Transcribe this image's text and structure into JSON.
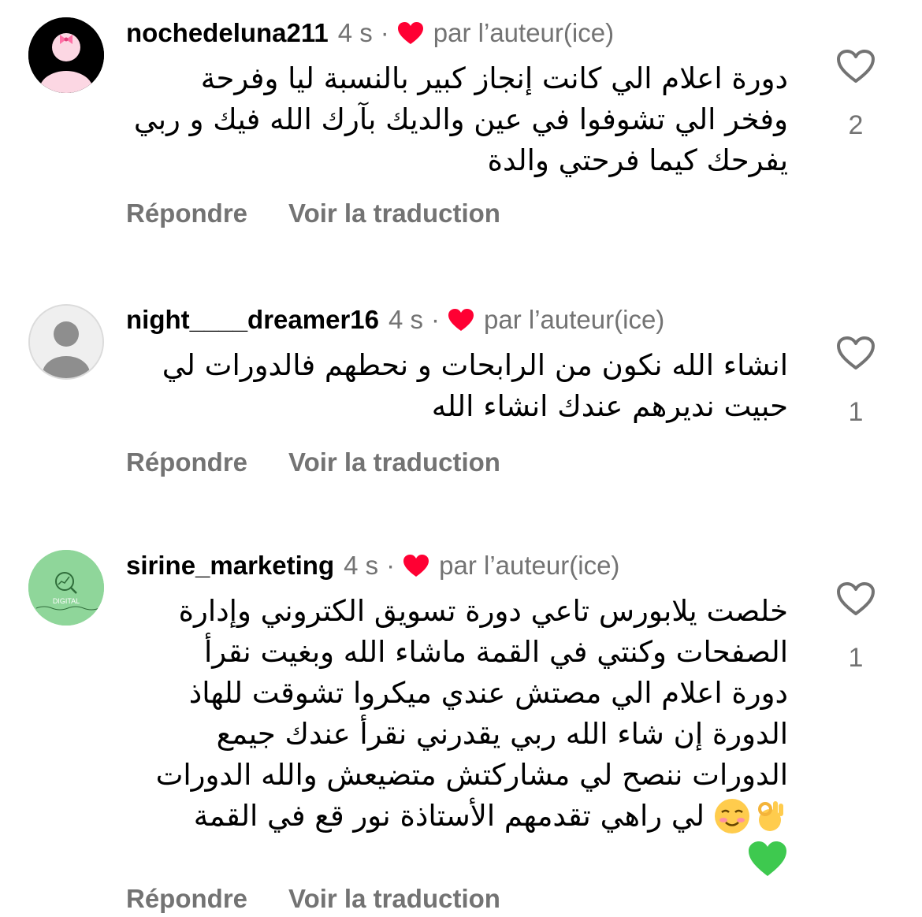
{
  "comments": [
    {
      "username": "nochedeluna211",
      "time": "4 s",
      "separator": "·",
      "by_author": "par l’auteur(ice)",
      "text_lines": [
        "دورة اعلام الي كانت إنجاز كبير بالنسبة ليا وفرحة",
        "وفخر الي تشوفوا في عين والديك بآرك الله فيك و ربي",
        "يفرحك كيما فرحتي والدة"
      ],
      "reply_label": "Répondre",
      "translate_label": "Voir la traduction",
      "like_count": "2",
      "avatar": "pink-bow-avatar"
    },
    {
      "username": "night____dreamer16",
      "time": "4 s",
      "separator": "·",
      "by_author": "par l’auteur(ice)",
      "text_lines": [
        "انشاء الله نكون من الرابحات و نحطهم فالدورات لي",
        "حبيت نديرهم عندك انشاء الله"
      ],
      "reply_label": "Répondre",
      "translate_label": "Voir la traduction",
      "like_count": "1",
      "avatar": "default-user-avatar"
    },
    {
      "username": "sirine_marketing",
      "time": "4 s",
      "separator": "·",
      "by_author": "par l’auteur(ice)",
      "text_lines": [
        "خلصت يلابورس تاعي  دورة تسويق الكتروني وإدارة",
        "الصفحات وكنتي في القمة ماشاء الله وبغيت نقرأ",
        "دورة اعلام الي مصتش عندي ميكروا  تشوقت للهاذ",
        "الدورة إن شاء الله ربي يقدرني  نقرأ عندك جيمع",
        "الدورات ننصح لي مشاركتش متضيعش والله الدورات",
        "لي راهي تقدمهم الأستاذة نور قع في القمة"
      ],
      "emojis": [
        "smiling-face-emoji",
        "ok-hand-emoji",
        "green-heart-emoji"
      ],
      "reply_label": "Répondre",
      "translate_label": "Voir la traduction",
      "like_count": "1",
      "avatar": "digital-marketing-avatar",
      "avatar_text": "DIGITAL"
    }
  ],
  "colors": {
    "secondary_text": "#737373",
    "heart_red": "#ff0033",
    "green_avatar": "#8fd69a"
  }
}
